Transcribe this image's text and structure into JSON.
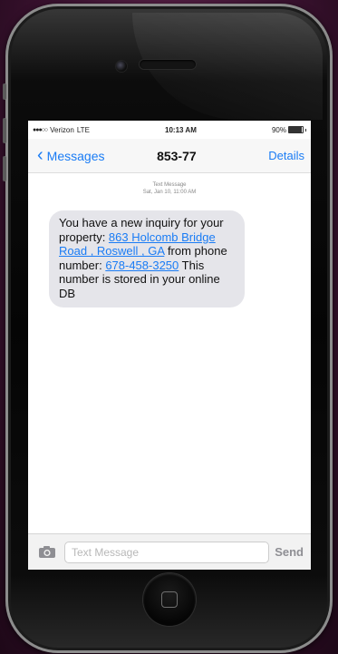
{
  "status_bar": {
    "carrier": "Verizon",
    "network": "LTE",
    "time": "10:13 AM",
    "battery": "90%",
    "battery_level": 0.9
  },
  "nav": {
    "back_label": "Messages",
    "title": "853-77",
    "details_label": "Details"
  },
  "thread": {
    "meta_label": "Text Message",
    "meta_date": "Sat, Jan 10, 11:00 AM"
  },
  "message": {
    "text_1": "You have a new inquiry for your property: ",
    "link_address": "863 Holcomb Bridge Road , Roswell , GA",
    "text_2": " from phone number: ",
    "link_phone": "678-458-3250",
    "text_3": " This number is stored in your online DB"
  },
  "input": {
    "placeholder": "Text Message",
    "send_label": "Send"
  },
  "colors": {
    "accent": "#1a7cf5",
    "bubble": "#e5e5ea",
    "background": "#3b1230"
  },
  "icons": {
    "back": "chevron-left-icon",
    "camera": "camera-icon",
    "home": "home-button-icon"
  }
}
